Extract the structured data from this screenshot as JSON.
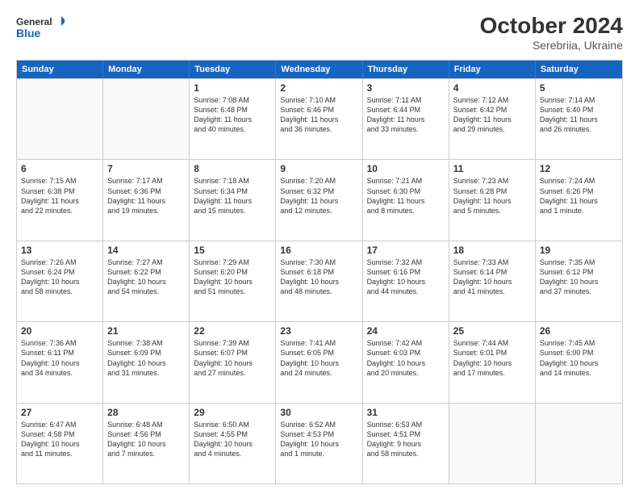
{
  "header": {
    "logo_general": "General",
    "logo_blue": "Blue",
    "month": "October 2024",
    "location": "Serebriia, Ukraine"
  },
  "days_of_week": [
    "Sunday",
    "Monday",
    "Tuesday",
    "Wednesday",
    "Thursday",
    "Friday",
    "Saturday"
  ],
  "weeks": [
    [
      {
        "day": "",
        "lines": []
      },
      {
        "day": "",
        "lines": []
      },
      {
        "day": "1",
        "lines": [
          "Sunrise: 7:08 AM",
          "Sunset: 6:48 PM",
          "Daylight: 11 hours",
          "and 40 minutes."
        ]
      },
      {
        "day": "2",
        "lines": [
          "Sunrise: 7:10 AM",
          "Sunset: 6:46 PM",
          "Daylight: 11 hours",
          "and 36 minutes."
        ]
      },
      {
        "day": "3",
        "lines": [
          "Sunrise: 7:11 AM",
          "Sunset: 6:44 PM",
          "Daylight: 11 hours",
          "and 33 minutes."
        ]
      },
      {
        "day": "4",
        "lines": [
          "Sunrise: 7:12 AM",
          "Sunset: 6:42 PM",
          "Daylight: 11 hours",
          "and 29 minutes."
        ]
      },
      {
        "day": "5",
        "lines": [
          "Sunrise: 7:14 AM",
          "Sunset: 6:40 PM",
          "Daylight: 11 hours",
          "and 26 minutes."
        ]
      }
    ],
    [
      {
        "day": "6",
        "lines": [
          "Sunrise: 7:15 AM",
          "Sunset: 6:38 PM",
          "Daylight: 11 hours",
          "and 22 minutes."
        ]
      },
      {
        "day": "7",
        "lines": [
          "Sunrise: 7:17 AM",
          "Sunset: 6:36 PM",
          "Daylight: 11 hours",
          "and 19 minutes."
        ]
      },
      {
        "day": "8",
        "lines": [
          "Sunrise: 7:18 AM",
          "Sunset: 6:34 PM",
          "Daylight: 11 hours",
          "and 15 minutes."
        ]
      },
      {
        "day": "9",
        "lines": [
          "Sunrise: 7:20 AM",
          "Sunset: 6:32 PM",
          "Daylight: 11 hours",
          "and 12 minutes."
        ]
      },
      {
        "day": "10",
        "lines": [
          "Sunrise: 7:21 AM",
          "Sunset: 6:30 PM",
          "Daylight: 11 hours",
          "and 8 minutes."
        ]
      },
      {
        "day": "11",
        "lines": [
          "Sunrise: 7:23 AM",
          "Sunset: 6:28 PM",
          "Daylight: 11 hours",
          "and 5 minutes."
        ]
      },
      {
        "day": "12",
        "lines": [
          "Sunrise: 7:24 AM",
          "Sunset: 6:26 PM",
          "Daylight: 11 hours",
          "and 1 minute."
        ]
      }
    ],
    [
      {
        "day": "13",
        "lines": [
          "Sunrise: 7:26 AM",
          "Sunset: 6:24 PM",
          "Daylight: 10 hours",
          "and 58 minutes."
        ]
      },
      {
        "day": "14",
        "lines": [
          "Sunrise: 7:27 AM",
          "Sunset: 6:22 PM",
          "Daylight: 10 hours",
          "and 54 minutes."
        ]
      },
      {
        "day": "15",
        "lines": [
          "Sunrise: 7:29 AM",
          "Sunset: 6:20 PM",
          "Daylight: 10 hours",
          "and 51 minutes."
        ]
      },
      {
        "day": "16",
        "lines": [
          "Sunrise: 7:30 AM",
          "Sunset: 6:18 PM",
          "Daylight: 10 hours",
          "and 48 minutes."
        ]
      },
      {
        "day": "17",
        "lines": [
          "Sunrise: 7:32 AM",
          "Sunset: 6:16 PM",
          "Daylight: 10 hours",
          "and 44 minutes."
        ]
      },
      {
        "day": "18",
        "lines": [
          "Sunrise: 7:33 AM",
          "Sunset: 6:14 PM",
          "Daylight: 10 hours",
          "and 41 minutes."
        ]
      },
      {
        "day": "19",
        "lines": [
          "Sunrise: 7:35 AM",
          "Sunset: 6:12 PM",
          "Daylight: 10 hours",
          "and 37 minutes."
        ]
      }
    ],
    [
      {
        "day": "20",
        "lines": [
          "Sunrise: 7:36 AM",
          "Sunset: 6:11 PM",
          "Daylight: 10 hours",
          "and 34 minutes."
        ]
      },
      {
        "day": "21",
        "lines": [
          "Sunrise: 7:38 AM",
          "Sunset: 6:09 PM",
          "Daylight: 10 hours",
          "and 31 minutes."
        ]
      },
      {
        "day": "22",
        "lines": [
          "Sunrise: 7:39 AM",
          "Sunset: 6:07 PM",
          "Daylight: 10 hours",
          "and 27 minutes."
        ]
      },
      {
        "day": "23",
        "lines": [
          "Sunrise: 7:41 AM",
          "Sunset: 6:05 PM",
          "Daylight: 10 hours",
          "and 24 minutes."
        ]
      },
      {
        "day": "24",
        "lines": [
          "Sunrise: 7:42 AM",
          "Sunset: 6:03 PM",
          "Daylight: 10 hours",
          "and 20 minutes."
        ]
      },
      {
        "day": "25",
        "lines": [
          "Sunrise: 7:44 AM",
          "Sunset: 6:01 PM",
          "Daylight: 10 hours",
          "and 17 minutes."
        ]
      },
      {
        "day": "26",
        "lines": [
          "Sunrise: 7:45 AM",
          "Sunset: 6:00 PM",
          "Daylight: 10 hours",
          "and 14 minutes."
        ]
      }
    ],
    [
      {
        "day": "27",
        "lines": [
          "Sunrise: 6:47 AM",
          "Sunset: 4:58 PM",
          "Daylight: 10 hours",
          "and 11 minutes."
        ]
      },
      {
        "day": "28",
        "lines": [
          "Sunrise: 6:48 AM",
          "Sunset: 4:56 PM",
          "Daylight: 10 hours",
          "and 7 minutes."
        ]
      },
      {
        "day": "29",
        "lines": [
          "Sunrise: 6:50 AM",
          "Sunset: 4:55 PM",
          "Daylight: 10 hours",
          "and 4 minutes."
        ]
      },
      {
        "day": "30",
        "lines": [
          "Sunrise: 6:52 AM",
          "Sunset: 4:53 PM",
          "Daylight: 10 hours",
          "and 1 minute."
        ]
      },
      {
        "day": "31",
        "lines": [
          "Sunrise: 6:53 AM",
          "Sunset: 4:51 PM",
          "Daylight: 9 hours",
          "and 58 minutes."
        ]
      },
      {
        "day": "",
        "lines": []
      },
      {
        "day": "",
        "lines": []
      }
    ]
  ]
}
